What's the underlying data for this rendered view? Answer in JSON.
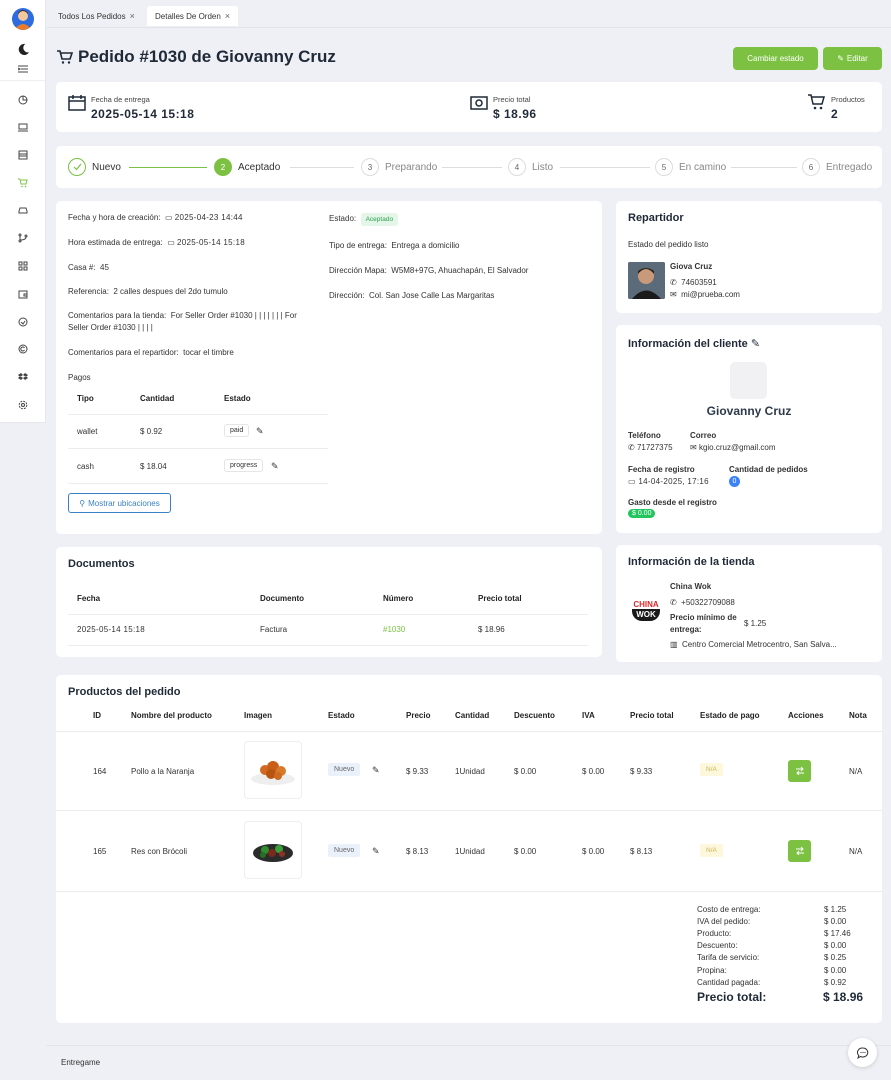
{
  "tabs": [
    "Todos Los Pedidos",
    "Detalles De Orden"
  ],
  "page_title": "Pedido #1030 de Giovanny Cruz",
  "actions": {
    "change_status": "Cambiar estado",
    "edit": "Editar"
  },
  "summary": {
    "delivery_label": "Fecha de entrega",
    "delivery_value": "2025-05-14 15:18",
    "price_label": "Precio total",
    "price_value": "$ 18.96",
    "products_label": "Productos",
    "products_value": "2"
  },
  "steps": [
    {
      "num": "",
      "label": "Nuevo"
    },
    {
      "num": "2",
      "label": "Aceptado"
    },
    {
      "num": "3",
      "label": "Preparando"
    },
    {
      "num": "4",
      "label": "Listo"
    },
    {
      "num": "5",
      "label": "En camino"
    },
    {
      "num": "6",
      "label": "Entregado"
    }
  ],
  "details": {
    "created_label": "Fecha y hora de creación:",
    "created_value": "2025-04-23 14:44",
    "eta_label": "Hora estimada de entrega:",
    "eta_value": "2025-05-14 15:18",
    "house_label": "Casa #:",
    "house_value": "45",
    "ref_label": "Referencia:",
    "ref_value": "2 calles despues del 2do tumulo",
    "store_comments_label": "Comentarios para la tienda:",
    "store_comments_l1": "For Seller Order #1030 | | | | | | | For",
    "store_comments_l2": "Seller Order #1030 | | | |",
    "driver_comments_label": "Comentarios para el repartidor:",
    "driver_comments_value": "tocar el timbre",
    "status_label": "Estado:",
    "status_value": "Aceptado",
    "delivery_type_label": "Tipo de entrega:",
    "delivery_type_value": "Entrega a domicilio",
    "map_label": "Dirección Mapa:",
    "map_value": "W5M8+97G, Ahuachapán, El Salvador",
    "address_label": "Dirección:",
    "address_value": "Col. San Jose Calle Las Margaritas",
    "payments_label": "Pagos",
    "payments_headers": [
      "Tipo",
      "Cantidad",
      "Estado"
    ],
    "payments": [
      {
        "type": "wallet",
        "amount": "$ 0.92",
        "status": "paid"
      },
      {
        "type": "cash",
        "amount": "$ 18.04",
        "status": "progress"
      }
    ],
    "show_locations": "Mostrar ubicaciones"
  },
  "driver": {
    "title": "Repartidor",
    "status": "Estado del pedido listo",
    "name": "Giova Cruz",
    "phone": "74603591",
    "email": "mi@prueba.com"
  },
  "client": {
    "title": "Información del cliente",
    "name": "Giovanny Cruz",
    "phone_label": "Teléfono",
    "phone": "71727375",
    "email_label": "Correo",
    "email": "kgio.cruz@gmail.com",
    "reg_label": "Fecha de registro",
    "reg_value": "14-04-2025, 17:16",
    "orders_label": "Cantidad de pedidos",
    "orders_value": "0",
    "spent_label": "Gasto desde el registro",
    "spent_value": "$ 0.00"
  },
  "store": {
    "title": "Información de la tienda",
    "name": "China Wok",
    "logo_l1": "CHINA",
    "logo_l2": "WOK",
    "phone": "+50322709088",
    "min_label_l1": "Precio mínimo de",
    "min_label_l2": "entrega:",
    "min_value": "$ 1.25",
    "address": "Centro Comercial Metrocentro, San Salva..."
  },
  "documents": {
    "title": "Documentos",
    "headers": [
      "Fecha",
      "Documento",
      "Número",
      "Precio total"
    ],
    "rows": [
      {
        "date": "2025-05-14 15:18",
        "doc": "Factura",
        "num": "#1030",
        "total": "$ 18.96"
      }
    ]
  },
  "products": {
    "title": "Productos del pedido",
    "headers": [
      "ID",
      "Nombre del producto",
      "Imagen",
      "Estado",
      "Precio",
      "Cantidad",
      "Descuento",
      "IVA",
      "Precio total",
      "Estado de pago",
      "Acciones",
      "Nota"
    ],
    "rows": [
      {
        "id": "164",
        "name": "Pollo a la Naranja",
        "status": "Nuevo",
        "price": "$ 9.33",
        "qty": "1Unidad",
        "discount": "$ 0.00",
        "iva": "$ 0.00",
        "total": "$ 9.33",
        "pay": "N/A",
        "note": "N/A"
      },
      {
        "id": "165",
        "name": "Res con Brócoli",
        "status": "Nuevo",
        "price": "$ 8.13",
        "qty": "1Unidad",
        "discount": "$ 0.00",
        "iva": "$ 0.00",
        "total": "$ 8.13",
        "pay": "N/A",
        "note": "N/A"
      }
    ]
  },
  "totals": [
    {
      "label": "Costo de entrega:",
      "value": "$ 1.25"
    },
    {
      "label": "IVA del pedido:",
      "value": "$ 0.00"
    },
    {
      "label": "Producto:",
      "value": "$ 17.46"
    },
    {
      "label": "Descuento:",
      "value": "$ 0.00"
    },
    {
      "label": "Tarifa de servicio:",
      "value": "$ 0.25"
    },
    {
      "label": "Propina:",
      "value": "$ 0.00"
    },
    {
      "label": "Cantidad pagada:",
      "value": "$ 0.92"
    }
  ],
  "grand_total": {
    "label": "Precio total:",
    "value": "$ 18.96"
  },
  "footer": "Entregame",
  "colors": {
    "accent": "#7cc142",
    "background": "#eef0f5"
  }
}
